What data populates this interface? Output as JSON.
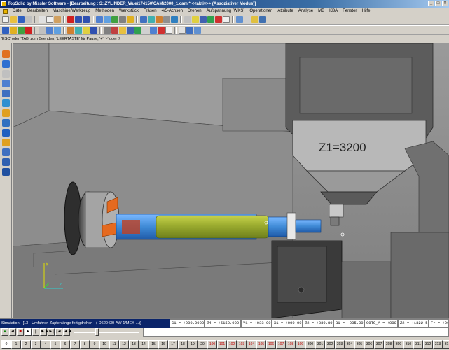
{
  "window": {
    "title": "TopSolid by Missler Software - [Bearbeitung : S:\\ZYLINDER_Wue\\174150\\CAM\\2000_1.cam *  <<aktiv>> (Assoziativer Modus)]",
    "controls": [
      "_",
      "□",
      "×"
    ]
  },
  "menu": [
    "Datei",
    "Bearbeiten",
    "Maschine/Werkzeug",
    "Methoden",
    "Werkstück",
    "Fräsen",
    "4/5-Achsen",
    "Drehen",
    "Aufspannung (WKS)",
    "Operationen",
    "Attribute",
    "Analyse",
    "MB",
    "KBA",
    "Fenster",
    "Hilfe"
  ],
  "hint": "'ESC' oder 'TAB' zum Beenden, 'LEERTASTE' für Pause, '+', '-' oder '/'",
  "viewport": {
    "label": "Z1=3200",
    "triad": [
      "X",
      "Z"
    ]
  },
  "status": {
    "simulation": "Simulation - [13 - Umfahren Zapfenlänge fertigdrehen - (-D620430-AW-1/MEX-...)]",
    "coords": [
      "C1 = +000.0000",
      "Z4 = +5150.000",
      "Y1 = +033.000",
      "X1 = +000.000",
      "Z2 = +339.800",
      "B1 = -005.0000",
      "GOTO_A = +000.0000",
      "Z2 = +1322.50(",
      "Fr = +000.30"
    ]
  },
  "controls": {
    "buttons": [
      "▲",
      "◄",
      "■",
      "►",
      "||",
      "►►",
      "►|",
      "|◄",
      "◄◄"
    ],
    "slider_value": 0.35
  },
  "numbers": [
    "0",
    "1",
    "2",
    "3",
    "4",
    "5",
    "6",
    "7",
    "8",
    "9",
    "10",
    "11",
    "12",
    "13",
    "14",
    "15",
    "16",
    "17",
    "18",
    "19",
    "20",
    "100",
    "101",
    "102",
    "103",
    "104",
    "105",
    "106",
    "107",
    "108",
    "109",
    "300",
    "301",
    "302",
    "303",
    "304",
    "305",
    "306",
    "307",
    "308",
    "309",
    "310",
    "311",
    "312",
    "313",
    "314",
    "315",
    "316"
  ],
  "colors": {
    "titlebar": "#0a246a",
    "part_green": "#9aab2f",
    "part_blue": "#3f8ad6",
    "chuck_orange": "#e56a20"
  }
}
